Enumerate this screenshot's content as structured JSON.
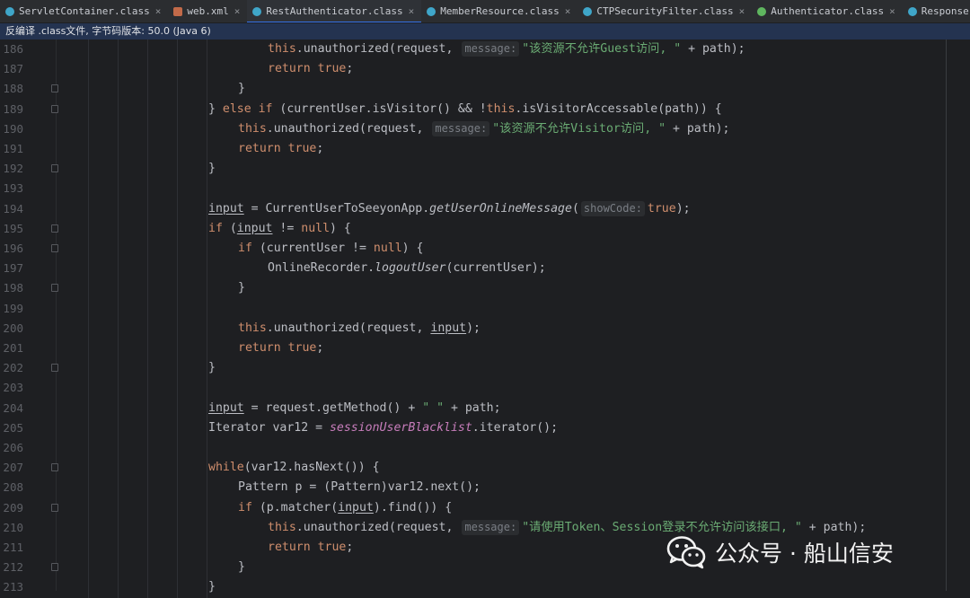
{
  "tabs": [
    {
      "label": "ServletContainer.class",
      "icon": "c"
    },
    {
      "label": "web.xml",
      "icon": "x"
    },
    {
      "label": "RestAuthenticator.class",
      "icon": "c",
      "active": true
    },
    {
      "label": "MemberResource.class",
      "icon": "c"
    },
    {
      "label": "CTPSecurityFilter.class",
      "icon": "c"
    },
    {
      "label": "Authenticator.class",
      "icon": "i"
    },
    {
      "label": "ResponseFilter.class",
      "icon": "c"
    }
  ],
  "banner": "反编译 .class文件, 字节码版本: 50.0 (Java 6)",
  "lines": [
    {
      "n": "186",
      "indent": 3,
      "fold": false,
      "html": "<span class='kw'>this</span>.unauthorized(request, <span class='hint'>message:</span><span class='str'>\"该资源不允许Guest访问, \"</span> + path);"
    },
    {
      "n": "187",
      "indent": 3,
      "fold": false,
      "html": "<span class='kw'>return true</span>;"
    },
    {
      "n": "188",
      "indent": 2,
      "fold": true,
      "html": "}"
    },
    {
      "n": "189",
      "indent": 1,
      "fold": true,
      "html": "} <span class='kw'>else if</span> (currentUser.isVisitor() &amp;&amp; !<span class='kw'>this</span>.isVisitorAccessable(path)) {"
    },
    {
      "n": "190",
      "indent": 2,
      "fold": false,
      "html": "<span class='kw'>this</span>.unauthorized(request, <span class='hint'>message:</span><span class='str'>\"该资源不允许Visitor访问, \"</span> + path);"
    },
    {
      "n": "191",
      "indent": 2,
      "fold": false,
      "html": "<span class='kw'>return true</span>;"
    },
    {
      "n": "192",
      "indent": 1,
      "fold": true,
      "html": "}"
    },
    {
      "n": "193",
      "indent": 1,
      "fold": false,
      "html": ""
    },
    {
      "n": "194",
      "indent": 1,
      "fold": false,
      "html": "<span class='ul'>input</span> = CurrentUserToSeeyonApp.<span class='ital'>getUserOnlineMessage</span>(<span class='hint'>showCode:</span><span class='kw'>true</span>);"
    },
    {
      "n": "195",
      "indent": 1,
      "fold": true,
      "html": "<span class='kw'>if</span> (<span class='ul'>input</span> != <span class='kw'>null</span>) {"
    },
    {
      "n": "196",
      "indent": 2,
      "fold": true,
      "html": "<span class='kw'>if</span> (currentUser != <span class='kw'>null</span>) {"
    },
    {
      "n": "197",
      "indent": 3,
      "fold": false,
      "html": "OnlineRecorder.<span class='ital'>logoutUser</span>(currentUser);"
    },
    {
      "n": "198",
      "indent": 2,
      "fold": true,
      "html": "}"
    },
    {
      "n": "199",
      "indent": 2,
      "fold": false,
      "html": ""
    },
    {
      "n": "200",
      "indent": 2,
      "fold": false,
      "html": "<span class='kw'>this</span>.unauthorized(request, <span class='ul'>input</span>);"
    },
    {
      "n": "201",
      "indent": 2,
      "fold": false,
      "html": "<span class='kw'>return true</span>;"
    },
    {
      "n": "202",
      "indent": 1,
      "fold": true,
      "html": "}"
    },
    {
      "n": "203",
      "indent": 1,
      "fold": false,
      "html": ""
    },
    {
      "n": "204",
      "indent": 1,
      "fold": false,
      "html": "<span class='ul'>input</span> = request.getMethod() + <span class='str'>\" \"</span> + path;"
    },
    {
      "n": "205",
      "indent": 1,
      "fold": false,
      "html": "Iterator var12 = <span class='fld'>sessionUserBlacklist</span>.iterator();"
    },
    {
      "n": "206",
      "indent": 1,
      "fold": false,
      "html": ""
    },
    {
      "n": "207",
      "indent": 1,
      "fold": true,
      "html": "<span class='kw'>while</span>(var12.hasNext()) {"
    },
    {
      "n": "208",
      "indent": 2,
      "fold": false,
      "html": "Pattern p = (Pattern)var12.next();"
    },
    {
      "n": "209",
      "indent": 2,
      "fold": true,
      "html": "<span class='kw'>if</span> (p.matcher(<span class='ul'>input</span>).find()) {"
    },
    {
      "n": "210",
      "indent": 3,
      "fold": false,
      "html": "<span class='kw'>this</span>.unauthorized(request, <span class='hint'>message:</span><span class='str'>\"请使用Token、Session登录不允许访问该接口, \"</span> + path);"
    },
    {
      "n": "211",
      "indent": 3,
      "fold": false,
      "html": "<span class='kw'>return true</span>;"
    },
    {
      "n": "212",
      "indent": 2,
      "fold": true,
      "html": "}"
    },
    {
      "n": "213",
      "indent": 1,
      "fold": false,
      "html": "}"
    }
  ],
  "watermark": {
    "text": "公众号 · 船山信安",
    "icon": "wechat-icon"
  },
  "colors": {
    "background": "#1e1f22",
    "keyword": "#cf8e6d",
    "string": "#6aab73",
    "field": "#c77dbb",
    "accent": "#3574f0"
  }
}
